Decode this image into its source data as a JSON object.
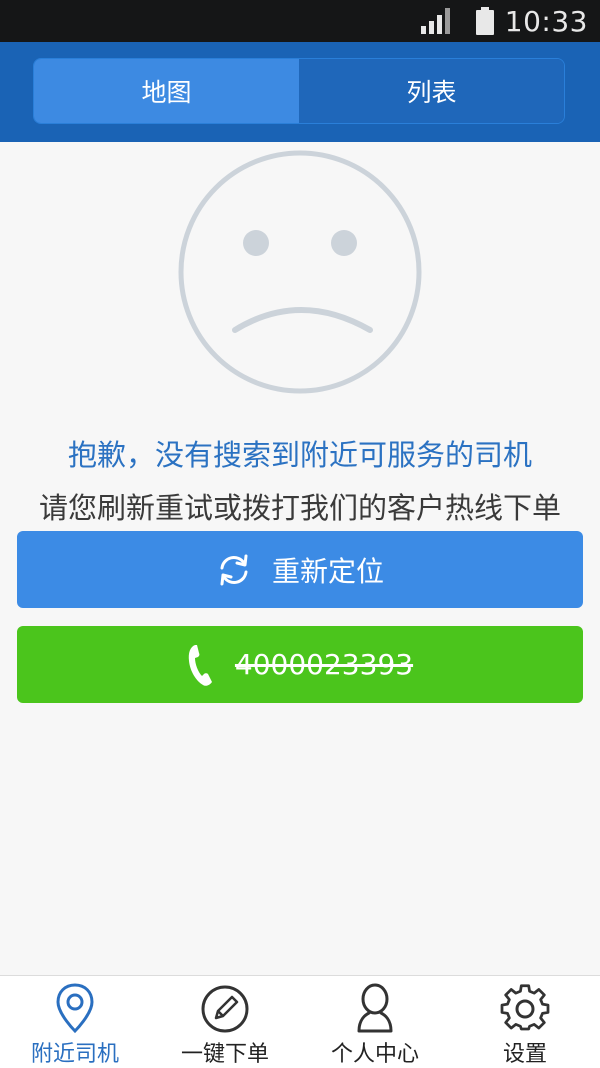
{
  "status_bar": {
    "time": "10:33"
  },
  "header": {
    "tabs": [
      {
        "label": "地图",
        "active": true
      },
      {
        "label": "列表",
        "active": false
      }
    ]
  },
  "empty_state": {
    "title": "抱歉，没有搜索到附近可服务的司机",
    "subtitle": "请您刷新重试或拨打我们的客户热线下单"
  },
  "actions": {
    "relocate_label": "重新定位",
    "hotline_number": "4000023393"
  },
  "bottom_nav": {
    "items": [
      {
        "label": "附近司机",
        "icon": "location-pin-icon",
        "active": true
      },
      {
        "label": "一键下单",
        "icon": "pencil-icon",
        "active": false
      },
      {
        "label": "个人中心",
        "icon": "person-icon",
        "active": false
      },
      {
        "label": "设置",
        "icon": "gear-icon",
        "active": false
      }
    ]
  },
  "colors": {
    "header_bg": "#1a63b5",
    "tab_active": "#3d8ae2",
    "relocate_button": "#3c8be5",
    "call_button": "#4bc51c",
    "title_text": "#2b72c2",
    "nav_active": "#2a6fc0"
  }
}
